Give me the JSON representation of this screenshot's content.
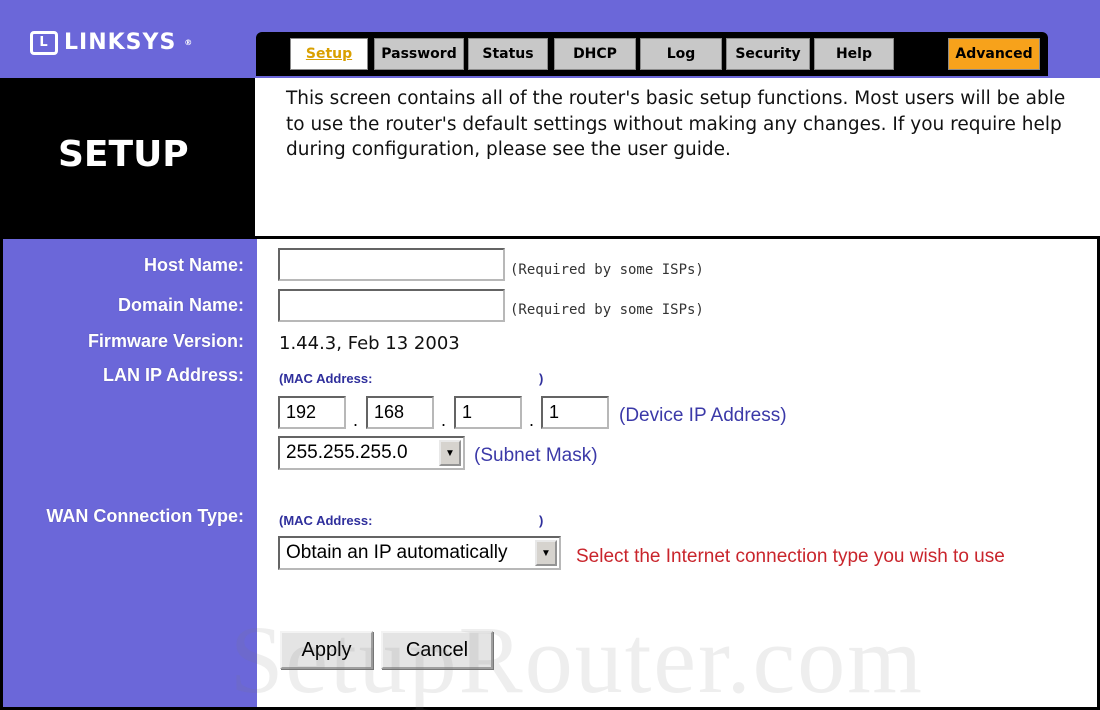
{
  "brand": {
    "logo_text": "LINKSYS",
    "logo_mark": "L",
    "registered": "®"
  },
  "tabs": [
    {
      "label": "Setup",
      "active": true
    },
    {
      "label": "Password"
    },
    {
      "label": "Status"
    },
    {
      "label": "DHCP"
    },
    {
      "label": "Log"
    },
    {
      "label": "Security"
    },
    {
      "label": "Help"
    },
    {
      "label": "Advanced"
    }
  ],
  "section": {
    "title": "SETUP",
    "description": "This screen contains all of the router's basic setup functions. Most users will be able to use the router's default settings without making any changes. If you require help during configuration, please see the user guide."
  },
  "form": {
    "host_name": {
      "label": "Host Name:",
      "value": "",
      "hint": "(Required by some ISPs)"
    },
    "domain_name": {
      "label": "Domain Name:",
      "value": "",
      "hint": "(Required by some ISPs)"
    },
    "firmware": {
      "label": "Firmware Version:",
      "value": "1.44.3, Feb 13 2003"
    },
    "lan": {
      "label": "LAN IP Address:",
      "mac_label": "(MAC Address:",
      "mac_close": ")",
      "octets": [
        "192",
        "168",
        "1",
        "1"
      ],
      "ip_hint": "(Device IP Address)",
      "subnet_value": "255.255.255.0",
      "subnet_hint": "(Subnet Mask)"
    },
    "wan": {
      "label": "WAN Connection Type:",
      "mac_label": "(MAC Address:",
      "mac_close": ")",
      "type_value": "Obtain an IP automatically",
      "type_hint": "Select the Internet connection type you wish to use"
    }
  },
  "buttons": {
    "apply": "Apply",
    "cancel": "Cancel"
  },
  "watermark": "SetupRouter.com",
  "colors": {
    "header": "#6b67d9",
    "advanced_tab": "#f7a21b",
    "active_tab_text": "#d9a000",
    "hint_blue": "#3b39a8",
    "hint_red": "#c9252c"
  }
}
